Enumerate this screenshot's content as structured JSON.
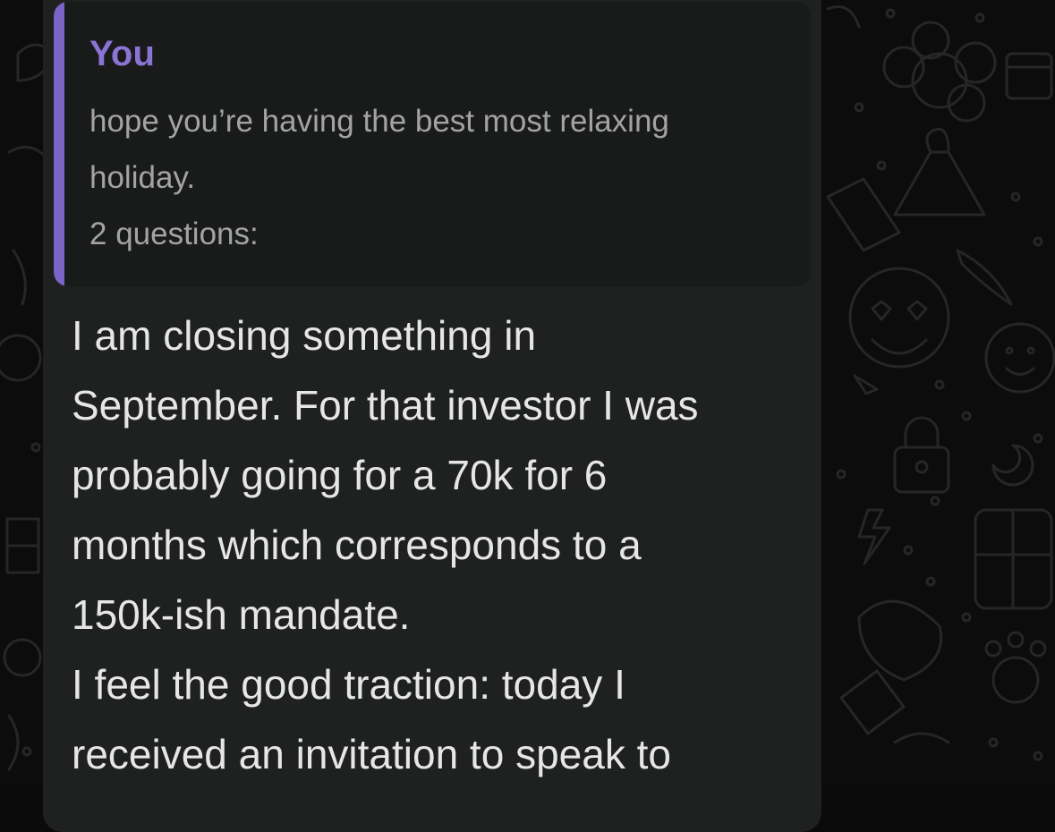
{
  "chat": {
    "background_color": "#0c0c0c",
    "bubble_color": "#1f2020",
    "accent_color": "#7a63c7"
  },
  "message": {
    "reply_quote": {
      "author": "You",
      "text": "hope you’re having the best most relaxing\nholiday.\n2 questions:"
    },
    "body": "I am closing something in\nSeptember. For that investor I was\nprobably going for a 70k for 6\nmonths which corresponds to a\n150k-ish mandate.\nI feel the good traction: today I\nreceived an invitation to speak to"
  },
  "icons": [
    "doodle-pattern-icon",
    "flower-icon",
    "calendar-icon",
    "volcano-icon",
    "heart-eyes-emoji-icon",
    "smiley-icon",
    "padlock-icon",
    "moon-icon",
    "lightning-icon",
    "calculator-icon",
    "paw-icon",
    "chili-icon"
  ]
}
